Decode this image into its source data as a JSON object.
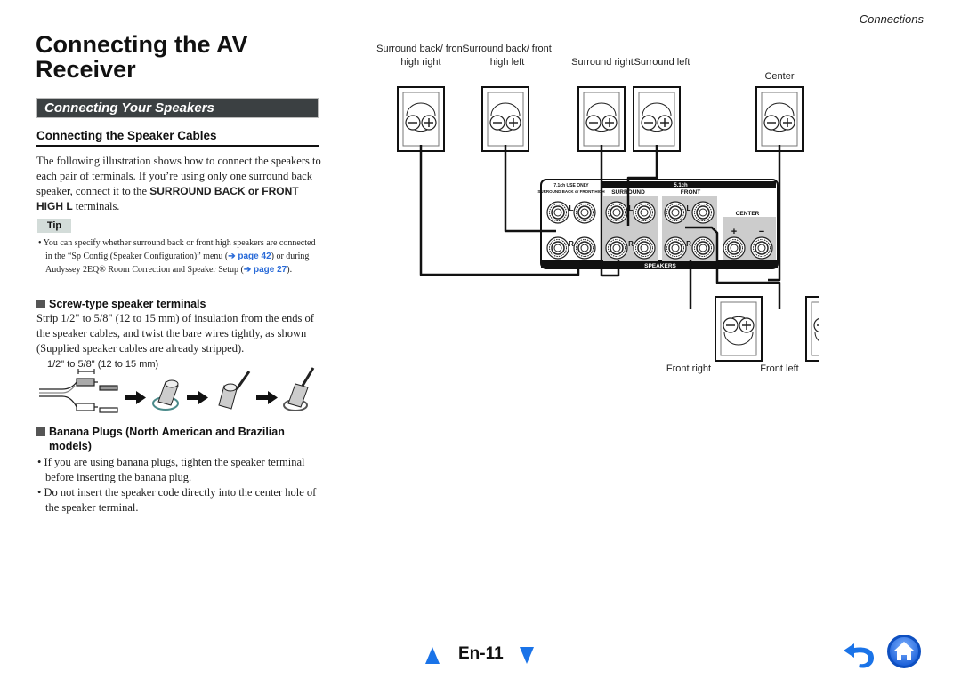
{
  "header": {
    "section": "Connections",
    "title": "Connecting the AV Receiver"
  },
  "subsection": "Connecting Your Speakers",
  "cables": {
    "heading": "Connecting the Speaker Cables",
    "intro_1": "The following illustration shows how to connect the speakers to each pair of terminals. If you’re using only one surround back speaker, connect it to the ",
    "intro_bold": "SURROUND BACK or FRONT HIGH L",
    "intro_2": " terminals."
  },
  "tip": {
    "label": "Tip",
    "text_1": "You can specify whether surround back or front high speakers are connected in the “Sp Config (Speaker Configuration)” menu (",
    "link_1": "➔ page 42",
    "text_2": ") or during Audyssey 2EQ® Room Correction and Speaker Setup (",
    "link_2": "➔ page 27",
    "text_3": ")."
  },
  "screw": {
    "heading": "Screw-type speaker terminals",
    "para": "Strip 1/2\" to 5/8\" (12 to 15 mm) of insulation from the ends of the speaker cables, and twist the bare wires tightly, as shown (Supplied speaker cables are already stripped).",
    "strip_label": "1/2\" to 5/8\" (12 to 15 mm)"
  },
  "banana": {
    "heading": "Banana Plugs (North American and Brazilian models)",
    "bullets": [
      "If you are using banana plugs, tighten the speaker terminal before inserting the banana plug.",
      "Do not insert the speaker code directly into the center hole of the speaker terminal."
    ]
  },
  "diagram": {
    "speakers": {
      "sb_right": "Surround back/ front high right",
      "sb_left": "Surround back/ front high left",
      "surround_right": "Surround right",
      "surround_left": "Surround left",
      "center": "Center",
      "front_right": "Front right",
      "front_left": "Front left"
    },
    "panel": {
      "only_71": "7.1ch USE ONLY",
      "sb_fh": "SURROUND BACK or FRONT HIGH",
      "surround": "SURROUND",
      "ch51": "5.1ch",
      "front": "FRONT",
      "center": "CENTER",
      "speakers": "SPEAKERS",
      "L": "L",
      "R": "R",
      "plus": "+",
      "minus": "−"
    }
  },
  "footer": {
    "page": "En-11",
    "prev_icon": "triangle-up",
    "next_icon": "triangle-down",
    "back_icon": "return-arrow",
    "home_icon": "home"
  },
  "colors": {
    "accent_blue": "#1a73e8",
    "link_blue": "#2a6bd8",
    "section_bar": "#3b4042",
    "tip_bg": "#d3dcd9"
  }
}
